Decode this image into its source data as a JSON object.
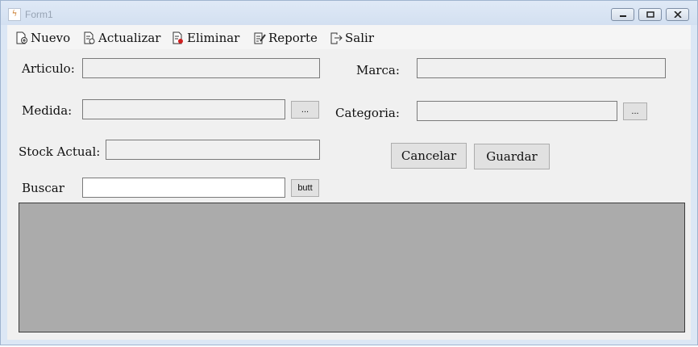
{
  "window": {
    "title": "Form1"
  },
  "menu": [
    {
      "label": "Nuevo",
      "icon": "new-document-icon"
    },
    {
      "label": "Actualizar",
      "icon": "refresh-document-icon"
    },
    {
      "label": "Eliminar",
      "icon": "delete-document-icon"
    },
    {
      "label": "Reporte",
      "icon": "report-edit-icon"
    },
    {
      "label": "Salir",
      "icon": "exit-icon"
    }
  ],
  "form": {
    "articulo_label": "Articulo:",
    "articulo_value": "",
    "marca_label": "Marca:",
    "marca_value": "",
    "medida_label": "Medida:",
    "medida_value": "",
    "medida_browse": "...",
    "categoria_label": "Categoria:",
    "categoria_value": "",
    "categoria_browse": "...",
    "stock_label": "Stock Actual:",
    "stock_value": "",
    "buscar_label": "Buscar",
    "buscar_value": "",
    "buscar_button": "butt"
  },
  "actions": {
    "cancel": "Cancelar",
    "save": "Guardar"
  }
}
